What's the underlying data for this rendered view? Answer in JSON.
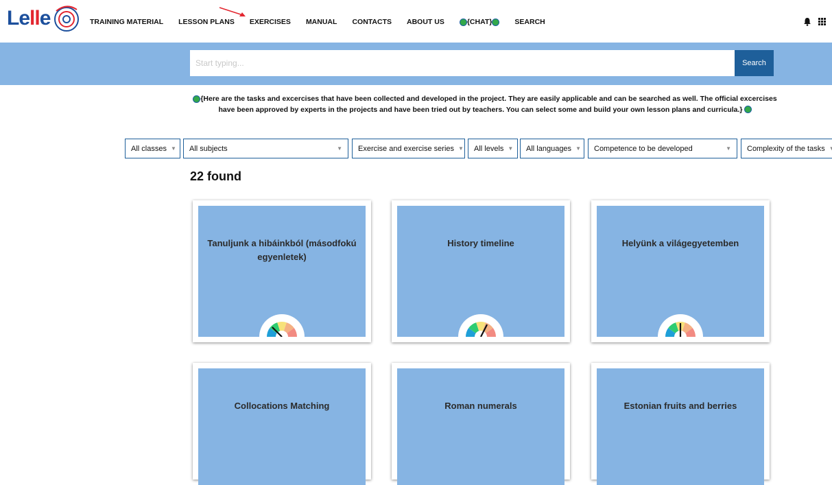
{
  "nav": {
    "logo_text": "Lelle",
    "items": [
      "TRAINING MATERIAL",
      "LESSON PLANS",
      "EXERCISES",
      "MANUAL",
      "CONTACTS",
      "ABOUT US",
      "{CHAT}",
      "SEARCH"
    ]
  },
  "search": {
    "placeholder": "Start typing...",
    "button_label": "Search"
  },
  "intro": {
    "text": "{Here are the tasks and excercises that have been collected and developed in the project. They are easily applicable and can be searched as well. The official excercises have been approved by experts in the projects and have been tried out by teachers. You can select some and build your own lesson plans and curricula.}"
  },
  "filters": [
    "All classes",
    "All subjects",
    "Exercise and exercise series",
    "All levels",
    "All languages",
    "Competence to be developed",
    "Complexity of the tasks"
  ],
  "results": {
    "count_label": "22 found"
  },
  "cards": [
    {
      "title": "Tanuljunk a hibáinkból (másodfokú egyenletek)",
      "difficulty": 0.25
    },
    {
      "title": "History timeline",
      "difficulty": 0.65
    },
    {
      "title": "Helyünk a világegyetemben",
      "difficulty": 0.5
    },
    {
      "title": "Collocations Matching"
    },
    {
      "title": "Roman numerals"
    },
    {
      "title": "Estonian fruits and berries"
    }
  ],
  "colors": {
    "band": "#86b4e3",
    "button": "#1e5f9a",
    "dot_green": "#33a84a",
    "logo_blue": "#1c4f9c",
    "logo_red": "#e3262f"
  }
}
